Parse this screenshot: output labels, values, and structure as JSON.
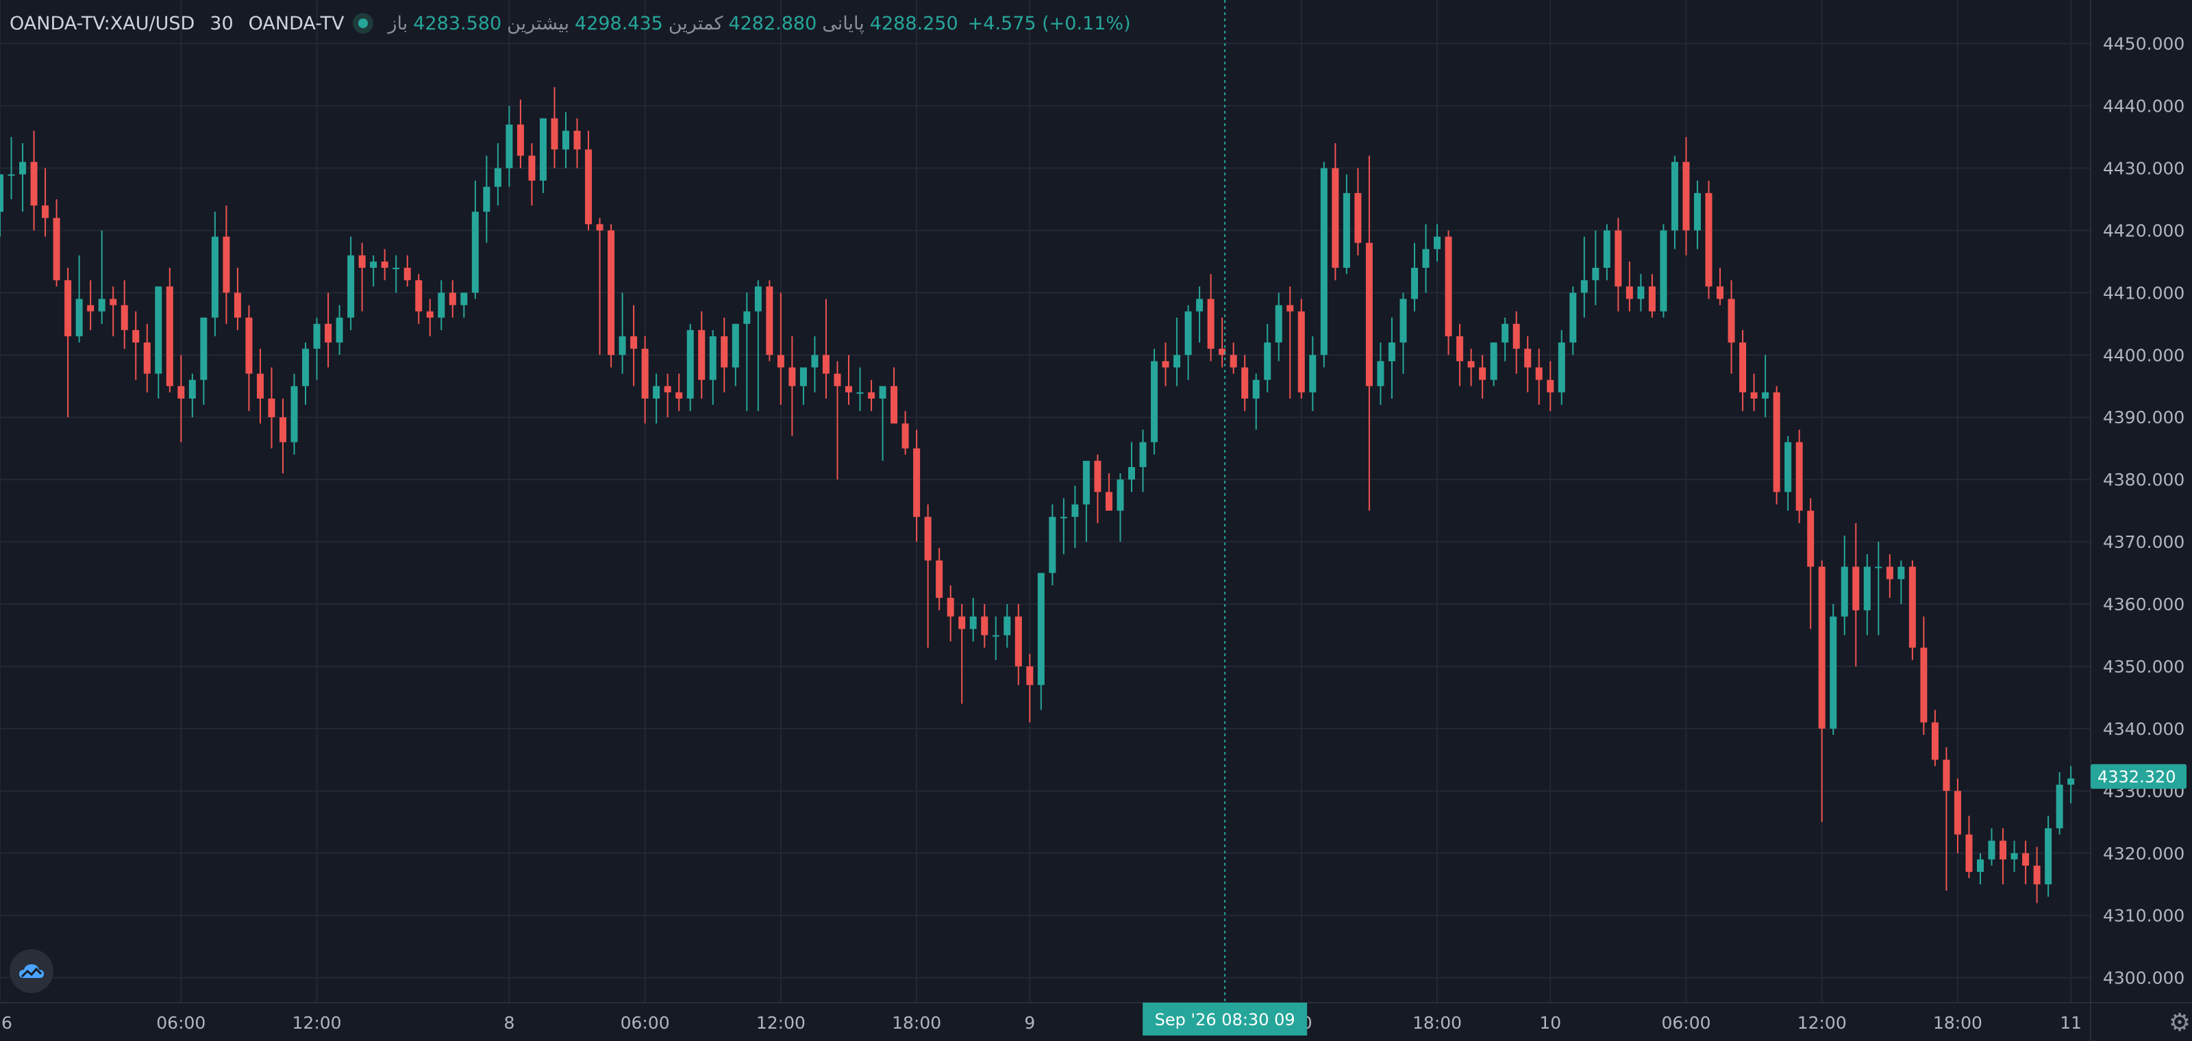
{
  "legend": {
    "symbol": "OANDA-TV:XAU/USD",
    "interval": "30",
    "exchange": "OANDA-TV",
    "open_label": "باز",
    "open_value": "4283.580",
    "high_label": "بیشترین",
    "high_value": "4298.435",
    "low_label": "کمترین",
    "low_value": "4282.880",
    "close_label": "پایانی",
    "close_value": "4288.250",
    "change": "+4.575 (+0.11%)"
  },
  "colors": {
    "up": "#26a69a",
    "down": "#ef5350",
    "background": "#161a25",
    "grid": "#232834",
    "text": "#b2b5be"
  },
  "icons": {
    "logo": "cloud-logo-icon",
    "settings": "gear-icon"
  },
  "chart_data": {
    "type": "candlestick",
    "interval": "30",
    "ylim": [
      4296,
      4457
    ],
    "y_ticks": [
      "4300.000",
      "4310.000",
      "4320.000",
      "4330.000",
      "4340.000",
      "4350.000",
      "4360.000",
      "4370.000",
      "4380.000",
      "4390.000",
      "4400.000",
      "4410.000",
      "4420.000",
      "4430.000",
      "4440.000",
      "4450.000"
    ],
    "x_ticks": [
      {
        "i": 0,
        "label": "6"
      },
      {
        "i": 16,
        "label": "06:00"
      },
      {
        "i": 28,
        "label": "12:00"
      },
      {
        "i": 45,
        "label": "8"
      },
      {
        "i": 57,
        "label": "06:00"
      },
      {
        "i": 69,
        "label": "12:00"
      },
      {
        "i": 81,
        "label": "18:00"
      },
      {
        "i": 91,
        "label": "9"
      },
      {
        "i": 115,
        "label": "00"
      },
      {
        "i": 127,
        "label": "18:00"
      },
      {
        "i": 137,
        "label": "10"
      },
      {
        "i": 149,
        "label": "06:00"
      },
      {
        "i": 161,
        "label": "12:00"
      },
      {
        "i": 173,
        "label": "18:00"
      },
      {
        "i": 183,
        "label": "11"
      }
    ],
    "crosshair": {
      "i": 108,
      "label": "Sep '26   08:30 09"
    },
    "last_price": "4332.320",
    "candles": [
      [
        4423,
        4429,
        4419,
        4429
      ],
      [
        4429,
        4435,
        4425,
        4429
      ],
      [
        4429,
        4434,
        4423,
        4431
      ],
      [
        4431,
        4436,
        4420,
        4424
      ],
      [
        4424,
        4430,
        4419,
        4422
      ],
      [
        4422,
        4425,
        4411,
        4412
      ],
      [
        4412,
        4414,
        4390,
        4403
      ],
      [
        4403,
        4416,
        4402,
        4409
      ],
      [
        4408,
        4412,
        4404,
        4407
      ],
      [
        4407,
        4420,
        4405,
        4409
      ],
      [
        4409,
        4411,
        4403,
        4408
      ],
      [
        4408,
        4412,
        4401,
        4404
      ],
      [
        4404,
        4407,
        4396,
        4402
      ],
      [
        4402,
        4405,
        4394,
        4397
      ],
      [
        4397,
        4406,
        4393,
        4411
      ],
      [
        4411,
        4414,
        4394,
        4395
      ],
      [
        4395,
        4400,
        4386,
        4393
      ],
      [
        4393,
        4397,
        4390,
        4396
      ],
      [
        4396,
        4406,
        4392,
        4406
      ],
      [
        4406,
        4423,
        4403,
        4419
      ],
      [
        4419,
        4424,
        4405,
        4410
      ],
      [
        4410,
        4414,
        4404,
        4406
      ],
      [
        4406,
        4408,
        4391,
        4397
      ],
      [
        4397,
        4401,
        4389,
        4393
      ],
      [
        4393,
        4398,
        4385,
        4390
      ],
      [
        4390,
        4393,
        4381,
        4386
      ],
      [
        4386,
        4397,
        4384,
        4395
      ],
      [
        4395,
        4402,
        4392,
        4401
      ],
      [
        4401,
        4406,
        4396,
        4405
      ],
      [
        4405,
        4410,
        4398,
        4402
      ],
      [
        4402,
        4408,
        4400,
        4406
      ],
      [
        4406,
        4419,
        4404,
        4416
      ],
      [
        4416,
        4418,
        4407,
        4414
      ],
      [
        4414,
        4416,
        4411,
        4415
      ],
      [
        4415,
        4417,
        4412,
        4414
      ],
      [
        4414,
        4416,
        4410,
        4414
      ],
      [
        4414,
        4416,
        4411,
        4412
      ],
      [
        4412,
        4413,
        4405,
        4407
      ],
      [
        4407,
        4409,
        4403,
        4406
      ],
      [
        4406,
        4412,
        4404,
        4410
      ],
      [
        4410,
        4412,
        4406,
        4408
      ],
      [
        4408,
        4410,
        4406,
        4410
      ],
      [
        4410,
        4428,
        4409,
        4423
      ],
      [
        4423,
        4432,
        4418,
        4427
      ],
      [
        4427,
        4434,
        4424,
        4430
      ],
      [
        4430,
        4440,
        4427,
        4437
      ],
      [
        4437,
        4441,
        4430,
        4432
      ],
      [
        4432,
        4434,
        4424,
        4428
      ],
      [
        4428,
        4438,
        4426,
        4438
      ],
      [
        4438,
        4443,
        4430,
        4433
      ],
      [
        4433,
        4439,
        4430,
        4436
      ],
      [
        4436,
        4438,
        4430,
        4433
      ],
      [
        4433,
        4436,
        4420,
        4421
      ],
      [
        4421,
        4422,
        4400,
        4420
      ],
      [
        4420,
        4421,
        4398,
        4400
      ],
      [
        4400,
        4410,
        4397,
        4403
      ],
      [
        4403,
        4408,
        4395,
        4401
      ],
      [
        4401,
        4403,
        4389,
        4393
      ],
      [
        4393,
        4397,
        4389,
        4395
      ],
      [
        4395,
        4397,
        4390,
        4394
      ],
      [
        4394,
        4397,
        4391,
        4393
      ],
      [
        4393,
        4405,
        4391,
        4404
      ],
      [
        4404,
        4407,
        4393,
        4396
      ],
      [
        4396,
        4404,
        4392,
        4403
      ],
      [
        4403,
        4406,
        4394,
        4398
      ],
      [
        4398,
        4405,
        4395,
        4405
      ],
      [
        4405,
        4410,
        4391,
        4407
      ],
      [
        4407,
        4412,
        4391,
        4411
      ],
      [
        4411,
        4412,
        4399,
        4400
      ],
      [
        4400,
        4410,
        4392,
        4398
      ],
      [
        4398,
        4403,
        4387,
        4395
      ],
      [
        4395,
        4398,
        4392,
        4398
      ],
      [
        4398,
        4403,
        4394,
        4400
      ],
      [
        4400,
        4409,
        4393,
        4397
      ],
      [
        4397,
        4399,
        4380,
        4395
      ],
      [
        4395,
        4400,
        4392,
        4394
      ],
      [
        4394,
        4398,
        4391,
        4394
      ],
      [
        4394,
        4396,
        4391,
        4393
      ],
      [
        4393,
        4395,
        4383,
        4395
      ],
      [
        4395,
        4398,
        4389,
        4389
      ],
      [
        4389,
        4391,
        4384,
        4385
      ],
      [
        4385,
        4388,
        4370,
        4374
      ],
      [
        4374,
        4376,
        4353,
        4367
      ],
      [
        4367,
        4369,
        4359,
        4361
      ],
      [
        4361,
        4363,
        4354,
        4358
      ],
      [
        4358,
        4360,
        4344,
        4356
      ],
      [
        4356,
        4361,
        4354,
        4358
      ],
      [
        4358,
        4360,
        4353,
        4355
      ],
      [
        4355,
        4358,
        4351,
        4355
      ],
      [
        4355,
        4360,
        4353,
        4358
      ],
      [
        4358,
        4360,
        4347,
        4350
      ],
      [
        4350,
        4352,
        4341,
        4347
      ],
      [
        4347,
        4365,
        4343,
        4365
      ],
      [
        4365,
        4376,
        4363,
        4374
      ],
      [
        4374,
        4377,
        4368,
        4374
      ],
      [
        4374,
        4379,
        4369,
        4376
      ],
      [
        4376,
        4383,
        4370,
        4383
      ],
      [
        4383,
        4384,
        4373,
        4378
      ],
      [
        4378,
        4381,
        4375,
        4375
      ],
      [
        4375,
        4381,
        4370,
        4380
      ],
      [
        4380,
        4386,
        4378,
        4382
      ],
      [
        4382,
        4388,
        4378,
        4386
      ],
      [
        4386,
        4401,
        4384,
        4399
      ],
      [
        4399,
        4402,
        4395,
        4398
      ],
      [
        4398,
        4406,
        4395,
        4400
      ],
      [
        4400,
        4408,
        4396,
        4407
      ],
      [
        4407,
        4411,
        4402,
        4409
      ],
      [
        4409,
        4413,
        4399,
        4401
      ],
      [
        4401,
        4406,
        4398,
        4400
      ],
      [
        4400,
        4402,
        4397,
        4398
      ],
      [
        4398,
        4400,
        4391,
        4393
      ],
      [
        4393,
        4397,
        4388,
        4396
      ],
      [
        4396,
        4405,
        4394,
        4402
      ],
      [
        4402,
        4410,
        4399,
        4408
      ],
      [
        4408,
        4411,
        4393,
        4407
      ],
      [
        4407,
        4409,
        4393,
        4394
      ],
      [
        4394,
        4403,
        4391,
        4400
      ],
      [
        4400,
        4431,
        4398,
        4430
      ],
      [
        4430,
        4434,
        4412,
        4414
      ],
      [
        4414,
        4429,
        4413,
        4426
      ],
      [
        4426,
        4430,
        4416,
        4418
      ],
      [
        4418,
        4432,
        4375,
        4395
      ],
      [
        4395,
        4402,
        4392,
        4399
      ],
      [
        4399,
        4406,
        4393,
        4402
      ],
      [
        4402,
        4410,
        4397,
        4409
      ],
      [
        4409,
        4418,
        4407,
        4414
      ],
      [
        4414,
        4421,
        4410,
        4417
      ],
      [
        4417,
        4421,
        4415,
        4419
      ],
      [
        4419,
        4420,
        4400,
        4403
      ],
      [
        4403,
        4405,
        4395,
        4399
      ],
      [
        4399,
        4401,
        4395,
        4398
      ],
      [
        4398,
        4400,
        4393,
        4396
      ],
      [
        4396,
        4402,
        4395,
        4402
      ],
      [
        4402,
        4406,
        4399,
        4405
      ],
      [
        4405,
        4407,
        4397,
        4401
      ],
      [
        4401,
        4403,
        4394,
        4398
      ],
      [
        4398,
        4401,
        4392,
        4396
      ],
      [
        4396,
        4399,
        4391,
        4394
      ],
      [
        4394,
        4404,
        4392,
        4402
      ],
      [
        4402,
        4411,
        4400,
        4410
      ],
      [
        4410,
        4419,
        4406,
        4412
      ],
      [
        4412,
        4420,
        4408,
        4414
      ],
      [
        4414,
        4421,
        4412,
        4420
      ],
      [
        4420,
        4422,
        4407,
        4411
      ],
      [
        4411,
        4415,
        4407,
        4409
      ],
      [
        4409,
        4413,
        4407,
        4411
      ],
      [
        4411,
        4413,
        4406,
        4407
      ],
      [
        4407,
        4421,
        4406,
        4420
      ],
      [
        4420,
        4432,
        4417,
        4431
      ],
      [
        4431,
        4435,
        4416,
        4420
      ],
      [
        4420,
        4428,
        4417,
        4426
      ],
      [
        4426,
        4428,
        4409,
        4411
      ],
      [
        4411,
        4414,
        4408,
        4409
      ],
      [
        4409,
        4412,
        4397,
        4402
      ],
      [
        4402,
        4404,
        4391,
        4394
      ],
      [
        4394,
        4397,
        4391,
        4393
      ],
      [
        4393,
        4400,
        4390,
        4394
      ],
      [
        4394,
        4395,
        4376,
        4378
      ],
      [
        4378,
        4387,
        4375,
        4386
      ],
      [
        4386,
        4388,
        4373,
        4375
      ],
      [
        4375,
        4377,
        4356,
        4366
      ],
      [
        4366,
        4367,
        4325,
        4340
      ],
      [
        4340,
        4360,
        4339,
        4358
      ],
      [
        4358,
        4371,
        4355,
        4366
      ],
      [
        4366,
        4373,
        4350,
        4359
      ],
      [
        4359,
        4368,
        4355,
        4366
      ],
      [
        4366,
        4370,
        4355,
        4366
      ],
      [
        4366,
        4368,
        4361,
        4364
      ],
      [
        4364,
        4367,
        4360,
        4366
      ],
      [
        4366,
        4367,
        4351,
        4353
      ],
      [
        4353,
        4358,
        4339,
        4341
      ],
      [
        4341,
        4343,
        4334,
        4335
      ],
      [
        4335,
        4337,
        4314,
        4330
      ],
      [
        4330,
        4332,
        4320,
        4323
      ],
      [
        4323,
        4326,
        4316,
        4317
      ],
      [
        4317,
        4320,
        4315,
        4319
      ],
      [
        4319,
        4324,
        4318,
        4322
      ],
      [
        4322,
        4324,
        4315,
        4319
      ],
      [
        4319,
        4322,
        4317,
        4320
      ],
      [
        4320,
        4322,
        4315,
        4318
      ],
      [
        4318,
        4321,
        4312,
        4315
      ],
      [
        4315,
        4326,
        4313,
        4324
      ],
      [
        4324,
        4333,
        4323,
        4331
      ],
      [
        4331,
        4334,
        4328,
        4332
      ]
    ]
  }
}
